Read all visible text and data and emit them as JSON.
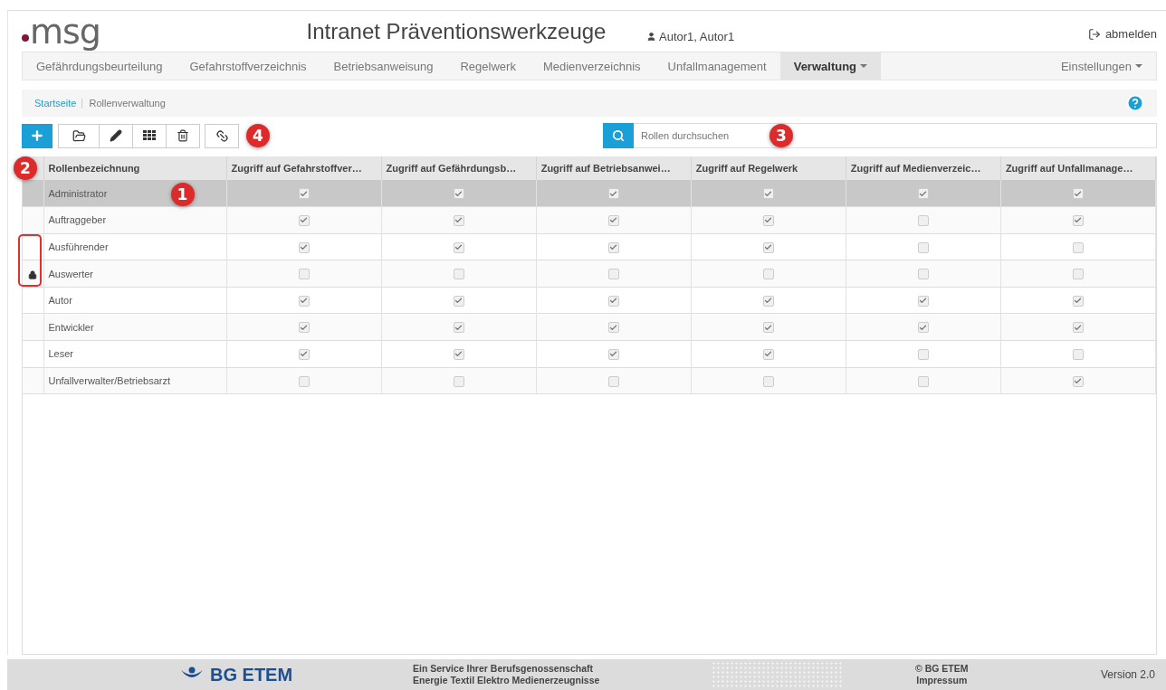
{
  "header": {
    "logo_text": "msg",
    "title": "Intranet Präventionswerkzeuge",
    "user": "Autor1, Autor1",
    "logout": "abmelden"
  },
  "nav": {
    "items": [
      {
        "label": "Gefährdungsbeurteilung",
        "selected": false,
        "dropdown": false
      },
      {
        "label": "Gefahrstoffverzeichnis",
        "selected": false,
        "dropdown": false
      },
      {
        "label": "Betriebsanweisung",
        "selected": false,
        "dropdown": false
      },
      {
        "label": "Regelwerk",
        "selected": false,
        "dropdown": false
      },
      {
        "label": "Medienverzeichnis",
        "selected": false,
        "dropdown": false
      },
      {
        "label": "Unfallmanagement",
        "selected": false,
        "dropdown": false
      },
      {
        "label": "Verwaltung",
        "selected": true,
        "dropdown": true
      }
    ],
    "settings": {
      "label": "Einstellungen",
      "dropdown": true
    }
  },
  "breadcrumb": [
    {
      "label": "Startseite",
      "link": true
    },
    {
      "label": "Rollenverwaltung",
      "link": false
    }
  ],
  "toolbar": {
    "buttons": [
      {
        "kind": "add",
        "primary": true
      },
      {
        "kind": "open",
        "primary": false
      },
      {
        "kind": "edit",
        "primary": false
      },
      {
        "kind": "grid",
        "primary": false
      },
      {
        "kind": "delete",
        "primary": false
      },
      {
        "kind": "link",
        "primary": false
      }
    ],
    "callout": "4"
  },
  "search": {
    "placeholder": "Rollen durchsuchen",
    "callout": "3"
  },
  "table": {
    "callout": "2",
    "columns": [
      "Rollenbezeichnung",
      "Zugriff auf Gefahrstoffver…",
      "Zugriff auf Gefährdungsb…",
      "Zugriff auf Betriebsanwei…",
      "Zugriff auf Regelwerk",
      "Zugriff auf Medienverzeic…",
      "Zugriff auf Unfallmanage…"
    ],
    "rows": [
      {
        "name": "Administrator",
        "callout": "1",
        "selected": true,
        "locked": false,
        "highlighted": false,
        "access": [
          true,
          true,
          true,
          true,
          true,
          true
        ]
      },
      {
        "name": "Auftraggeber",
        "selected": false,
        "locked": false,
        "highlighted": false,
        "access": [
          true,
          true,
          true,
          true,
          false,
          true
        ]
      },
      {
        "name": "Ausführender",
        "selected": false,
        "locked": false,
        "highlighted": true,
        "access": [
          true,
          true,
          true,
          true,
          false,
          false
        ]
      },
      {
        "name": "Auswerter",
        "selected": false,
        "locked": true,
        "highlighted": true,
        "access": [
          false,
          false,
          false,
          false,
          false,
          false
        ]
      },
      {
        "name": "Autor",
        "selected": false,
        "locked": false,
        "highlighted": false,
        "access": [
          true,
          true,
          true,
          true,
          true,
          true
        ]
      },
      {
        "name": "Entwickler",
        "selected": false,
        "locked": false,
        "highlighted": false,
        "access": [
          true,
          true,
          true,
          true,
          true,
          true
        ]
      },
      {
        "name": "Leser",
        "selected": false,
        "locked": false,
        "highlighted": false,
        "access": [
          true,
          true,
          true,
          true,
          false,
          false
        ]
      },
      {
        "name": "Unfallverwalter/Betriebsarzt",
        "selected": false,
        "locked": false,
        "highlighted": false,
        "access": [
          false,
          false,
          false,
          false,
          false,
          true
        ]
      }
    ]
  },
  "footer": {
    "logo_text": "BG ETEM",
    "service_lines": [
      "Ein Service Ihrer Berufsgenossenschaft",
      "Energie Textil Elektro Medienerzeugnisse"
    ],
    "copyright": "© BG ETEM",
    "imprint": "Impressum",
    "version": "Version 2.0"
  }
}
